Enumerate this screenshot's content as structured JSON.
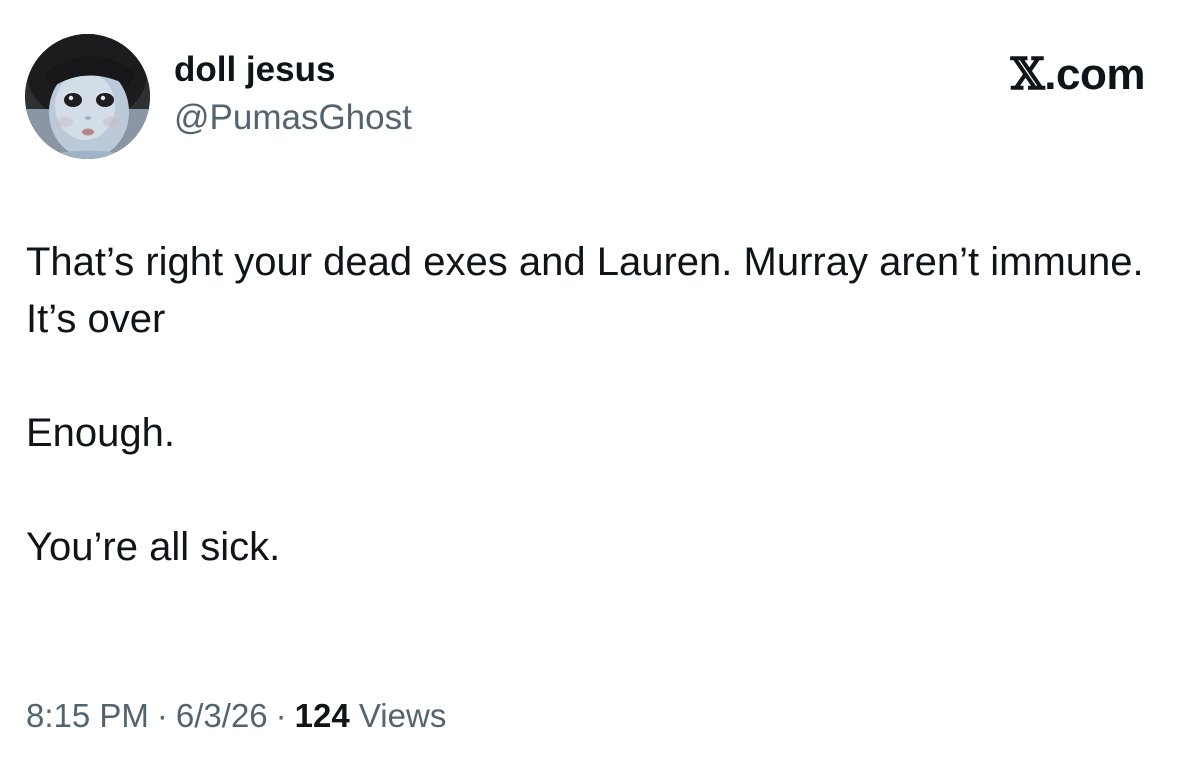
{
  "author": {
    "display_name": "doll jesus",
    "handle": "@PumasGhost"
  },
  "site": {
    "x_glyph": "𝕏",
    "suffix": ".com"
  },
  "tweet": {
    "paragraphs": [
      "That’s right your dead exes and Lauren. Murray aren’t immune. It’s over",
      "Enough.",
      "You’re all sick."
    ],
    "time": "8:15 PM",
    "separator": "·",
    "date": "6/3/26",
    "views_count": "124",
    "views_label": "Views"
  },
  "colors": {
    "text": "#0f1419",
    "secondary": "#536471",
    "background": "#ffffff"
  },
  "icons": {
    "avatar": "doll-face-avatar"
  }
}
